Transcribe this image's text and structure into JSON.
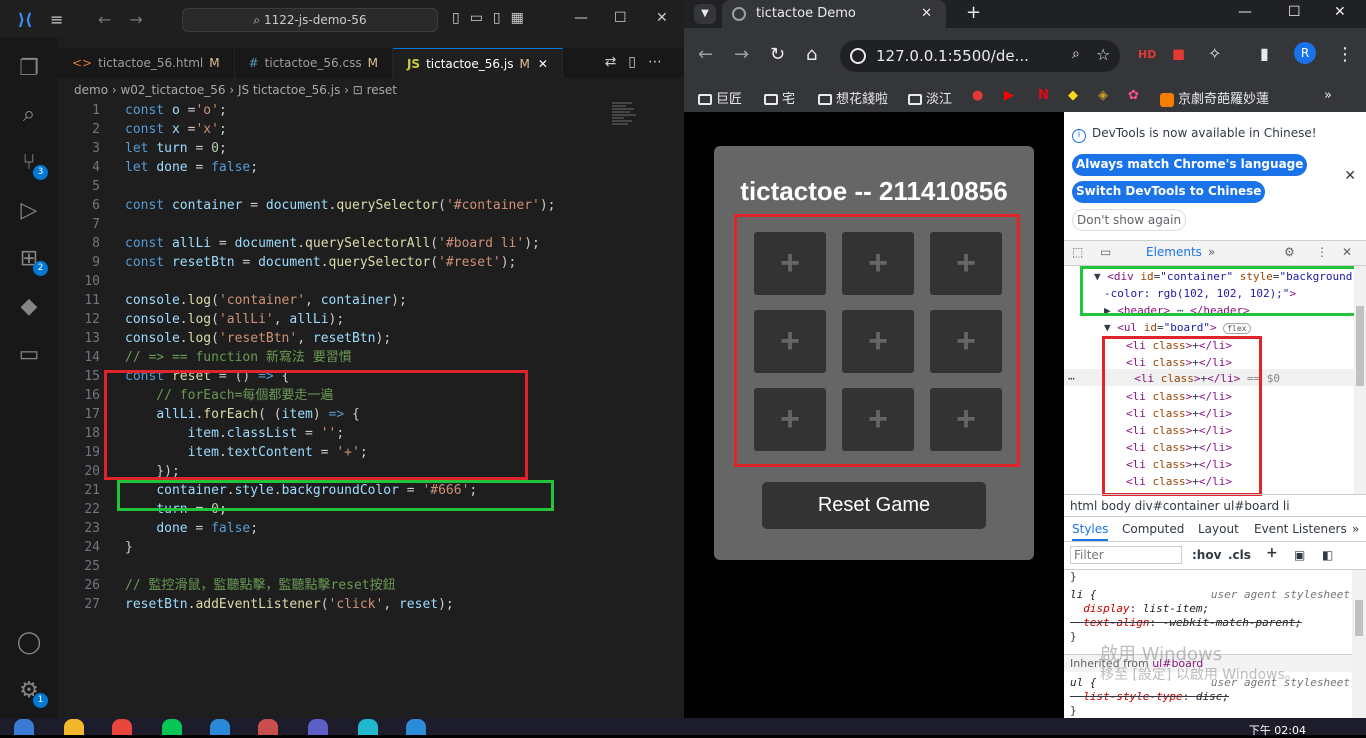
{
  "vscode": {
    "search_text": "⌕ 1122-js-demo-56",
    "tabs": [
      {
        "icon": "<>",
        "label": "tictactoe_56.html",
        "status": "M"
      },
      {
        "icon": "#",
        "label": "tictactoe_56.css",
        "status": "M"
      },
      {
        "icon": "JS",
        "label": "tictactoe_56.js",
        "status": "M"
      }
    ],
    "breadcrumb": "demo  ›  w02_tictactoe_56  ›  JS  tictactoe_56.js  ›  ⊡ reset",
    "badges": {
      "source_control": "3",
      "extensions": "2",
      "settings": "1"
    },
    "line_numbers": [
      "1",
      "2",
      "3",
      "4",
      "5",
      "6",
      "7",
      "8",
      "9",
      "10",
      "11",
      "12",
      "13",
      "14",
      "15",
      "16",
      "17",
      "18",
      "19",
      "20",
      "21",
      "22",
      "23",
      "24",
      "25",
      "26",
      "27"
    ]
  },
  "browser": {
    "tab_title": "tictactoe Demo",
    "url": "127.0.0.1:5500/de...",
    "bookmarks": [
      "巨匠",
      "宅",
      "想花錢啦",
      "淡江",
      "京劇奇葩羅妙蓮"
    ],
    "page": {
      "title": "tictactoe -- 211410856",
      "cells": [
        "+",
        "+",
        "+",
        "+",
        "+",
        "+",
        "+",
        "+",
        "+"
      ],
      "reset_label": "Reset Game",
      "container_bg": "#666666"
    }
  },
  "devtools": {
    "info": "DevTools is now available in Chinese!",
    "btn_match": "Always match Chrome's language",
    "btn_switch": "Switch DevTools to Chinese",
    "btn_dont": "Don't show again",
    "panel_tab": "Elements",
    "crumbs": "html   body   div#container   ul#board   li",
    "style_tabs": [
      "Styles",
      "Computed",
      "Layout",
      "Event Listeners"
    ],
    "filter_placeholder": "Filter",
    "hov": ":hov",
    "cls": ".cls",
    "inherited_prefix": "Inherited from ",
    "inherited_from": "ul#board",
    "ua_source": "user agent stylesheet"
  },
  "watermark": {
    "line1": "啟用 Windows",
    "line2": "移至 [設定] 以啟用 Windows。"
  },
  "taskbar": {
    "time": "下午 02:04"
  },
  "colors": {
    "accent": "#0078d4",
    "red_box": "#e0242b",
    "green_box": "#22c43a"
  }
}
